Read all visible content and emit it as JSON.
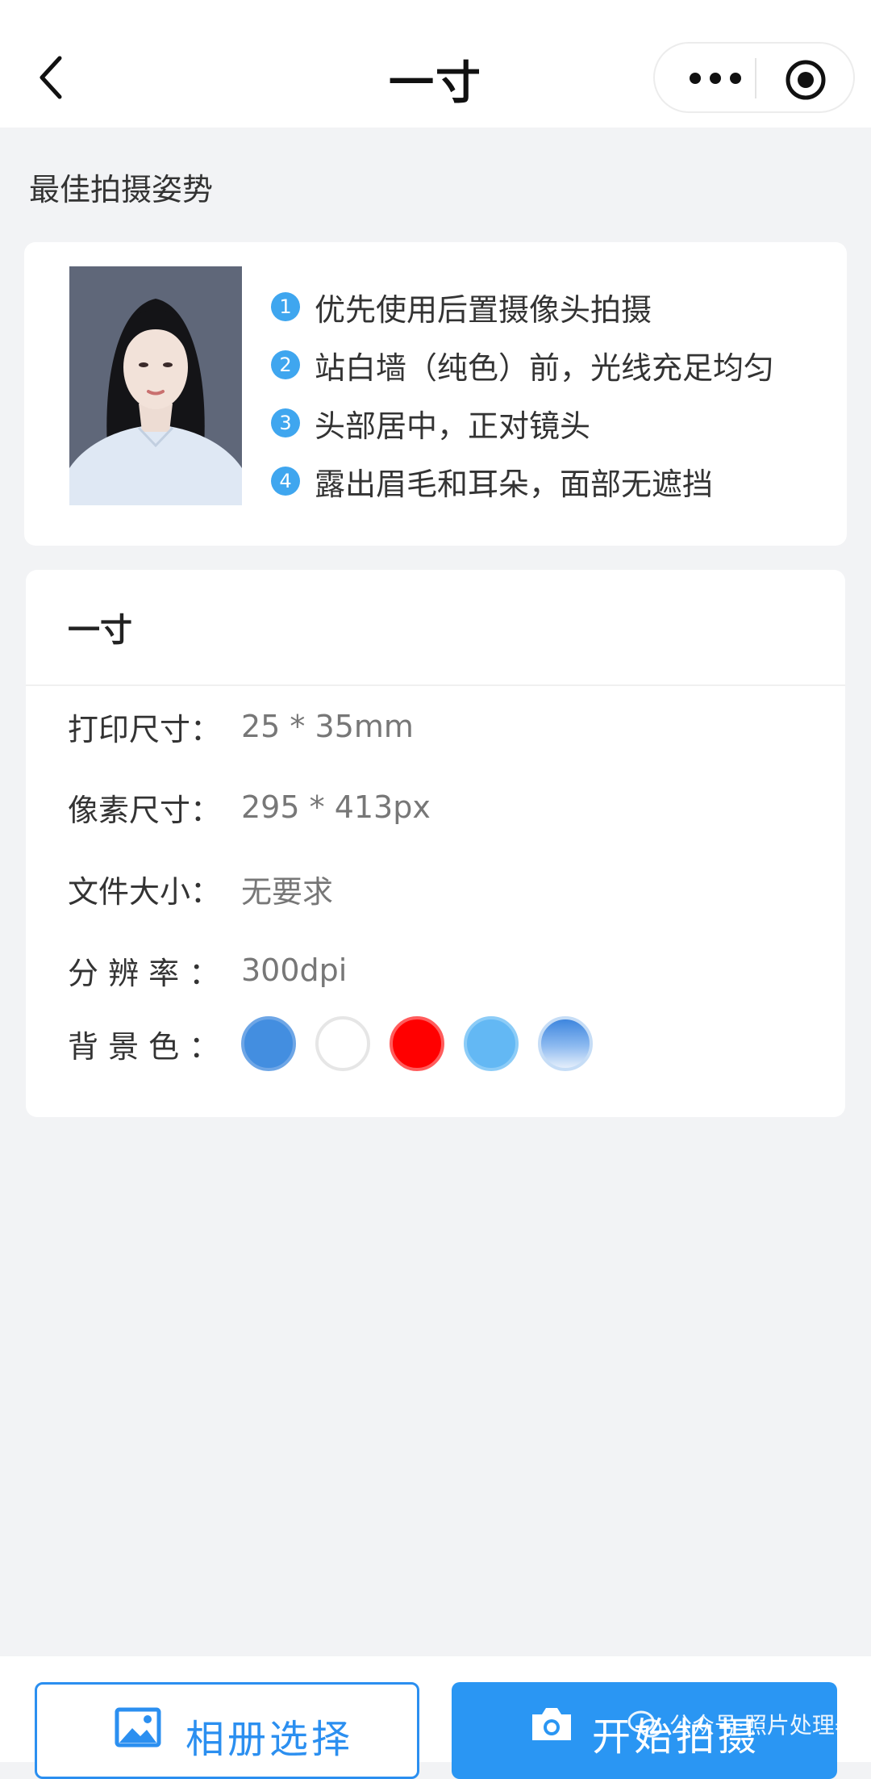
{
  "navbar": {
    "title": "一寸"
  },
  "pose": {
    "section_title": "最佳拍摄姿势",
    "tips": [
      {
        "num": "1",
        "text": "优先使用后置摄像头拍摄"
      },
      {
        "num": "2",
        "text": "站白墙（纯色）前，光线充足均匀"
      },
      {
        "num": "3",
        "text": "头部居中，正对镜头"
      },
      {
        "num": "4",
        "text": "露出眉毛和耳朵，面部无遮挡"
      }
    ]
  },
  "spec": {
    "title": "一寸",
    "rows": [
      {
        "label": "打印尺寸：",
        "value": "25 * 35mm"
      },
      {
        "label": "像素尺寸：",
        "value": "295 * 413px"
      },
      {
        "label": "文件大小：",
        "value": "无要求"
      },
      {
        "label": "分 辨 率 ：",
        "value": "300dpi"
      }
    ],
    "bg_label": "背 景 色 ：",
    "bg_colors": [
      "#438ee0",
      "#ffffff",
      "#ff0000",
      "#63b8f4",
      "gradient-blue"
    ]
  },
  "buttons": {
    "album": "相册选择",
    "shoot": "开始拍摄"
  },
  "watermark": {
    "text": "公众号·照片处理器"
  },
  "colors": {
    "accent": "#2a96f3",
    "page_bg": "#f2f3f5",
    "tip_badge": "#3fa6ef"
  }
}
